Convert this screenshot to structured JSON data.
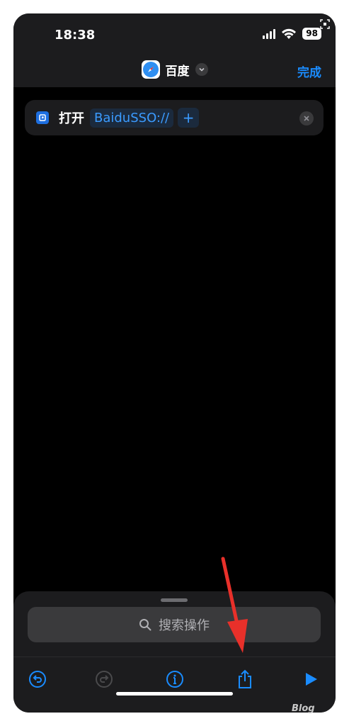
{
  "status_bar": {
    "time": "18:38",
    "battery": "98"
  },
  "nav": {
    "title": "百度",
    "done_label": "完成"
  },
  "action": {
    "verb": "打开",
    "url": "BaiduSSO://",
    "plus": "+"
  },
  "search": {
    "placeholder": "搜索操作"
  },
  "toolbar": {
    "buttons": [
      "undo-icon",
      "redo-icon",
      "info-icon",
      "share-icon",
      "play-icon"
    ],
    "accent": "#1a8cff",
    "disabled": "#4a4a4c"
  },
  "annotation": {
    "arrow_color": "#e8302a"
  },
  "watermark": {
    "text": "Blog"
  }
}
